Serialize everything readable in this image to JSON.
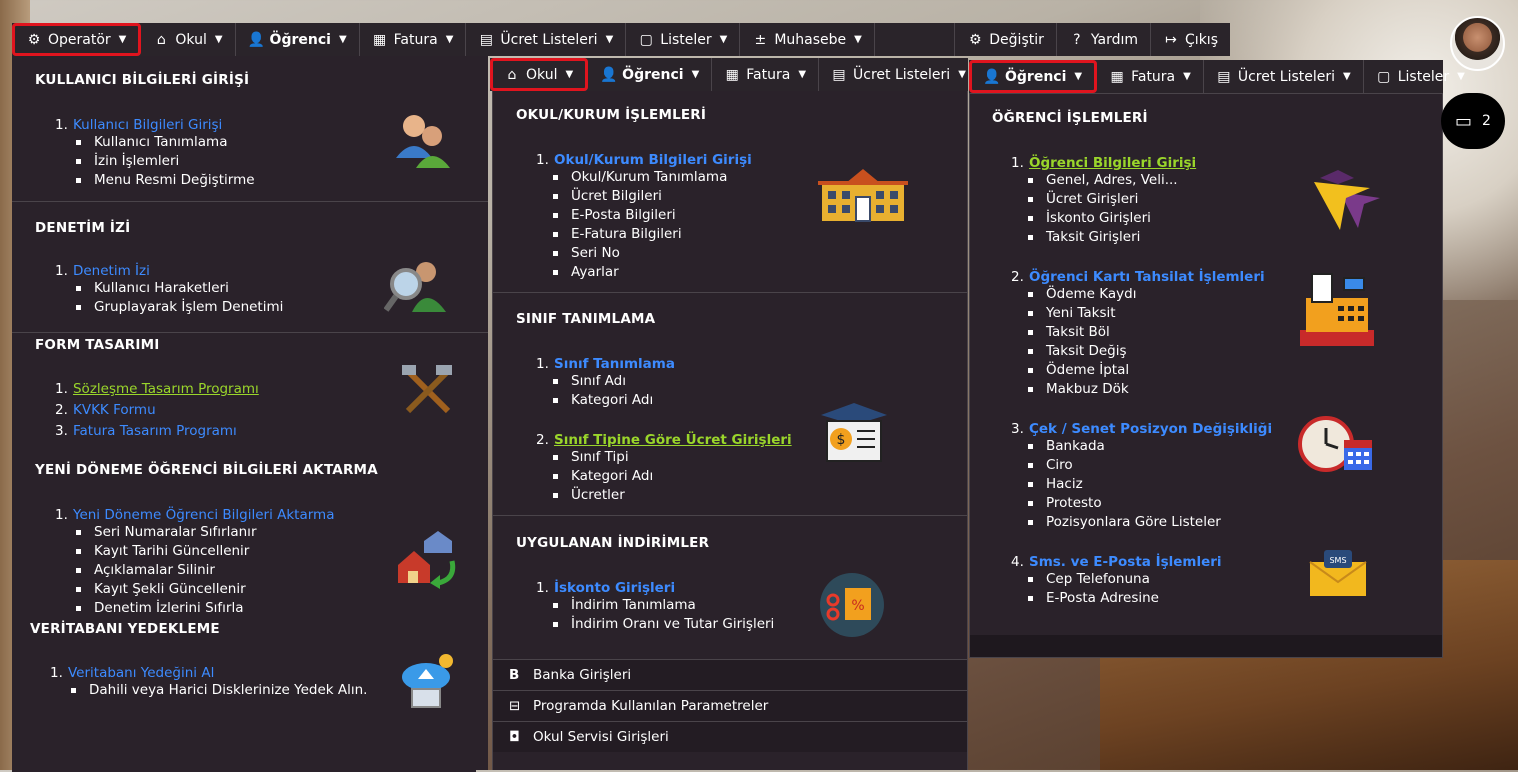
{
  "topbar": {
    "items": [
      {
        "label": "Operatör",
        "icon": "gears-icon"
      },
      {
        "label": "Okul",
        "icon": "home-icon"
      },
      {
        "label": "Öğrenci",
        "icon": "user-icon"
      },
      {
        "label": "Fatura",
        "icon": "calculator-icon"
      },
      {
        "label": "Ücret Listeleri",
        "icon": "document-icon"
      },
      {
        "label": "Listeler",
        "icon": "list-icon"
      },
      {
        "label": "Muhasebe",
        "icon": "plus-minus-icon"
      }
    ],
    "right_items": [
      {
        "label": "Değiştir",
        "icon": "gear-icon"
      },
      {
        "label": "Yardım",
        "icon": "help-icon"
      },
      {
        "label": "Çıkış",
        "icon": "exit-icon"
      }
    ]
  },
  "bar2": {
    "items": [
      {
        "label": "Okul"
      },
      {
        "label": "Öğrenci"
      },
      {
        "label": "Fatura"
      },
      {
        "label": "Ücret Listeleri"
      }
    ]
  },
  "bar3": {
    "items": [
      {
        "label": "Öğrenci"
      },
      {
        "label": "Fatura"
      },
      {
        "label": "Ücret Listeleri"
      },
      {
        "label": "Listeler"
      }
    ]
  },
  "operator_menu": {
    "s1": {
      "title": "KULLANICI BİLGİLERİ GİRİŞİ",
      "num": "1.",
      "link": "Kullanıcı Bilgileri Girişi",
      "subs": [
        "Kullanıcı Tanımlama",
        "İzin İşlemleri",
        "Menu Resmi Değiştirme"
      ]
    },
    "s2": {
      "title": "DENETİM İZİ",
      "num": "1.",
      "link": "Denetim İzi",
      "subs": [
        "Kullanıcı Haraketleri",
        "Gruplayarak İşlem Denetimi"
      ]
    },
    "s3": {
      "title": "FORM TASARIMI",
      "links": [
        {
          "num": "1.",
          "label": "Sözleşme Tasarım Programı"
        },
        {
          "num": "2.",
          "label": "KVKK Formu"
        },
        {
          "num": "3.",
          "label": "Fatura Tasarım Programı"
        }
      ]
    },
    "s4": {
      "title": "YENİ DÖNEME ÖĞRENCİ BİLGİLERİ AKTARMA",
      "num": "1.",
      "link": "Yeni Döneme Öğrenci Bilgileri Aktarma",
      "subs": [
        "Seri Numaralar Sıfırlanır",
        "Kayıt Tarihi Güncellenir",
        "Açıklamalar Silinir",
        "Kayıt Şekli Güncellenir",
        "Denetim İzlerini Sıfırla"
      ]
    },
    "s5": {
      "title": "VERİTABANI YEDEKLEME",
      "num": "1.",
      "link": "Veritabanı Yedeğini Al",
      "subs": [
        "Dahili veya Harici Disklerinize Yedek Alın."
      ]
    }
  },
  "okul_menu": {
    "s1": {
      "title": "OKUL/KURUM İŞLEMLERİ",
      "num": "1.",
      "link": "Okul/Kurum Bilgileri Girişi",
      "subs": [
        "Okul/Kurum Tanımlama",
        "Ücret Bilgileri",
        "E-Posta Bilgileri",
        "E-Fatura Bilgileri",
        "Seri No",
        "Ayarlar"
      ]
    },
    "s2": {
      "title": "SINIF TANIMLAMA",
      "num1": "1.",
      "link1": "Sınıf Tanımlama",
      "subs1": [
        "Sınıf Adı",
        "Kategori Adı"
      ],
      "num2": "2.",
      "link2": "Sınıf Tipine Göre Ücret Girişleri",
      "subs2": [
        "Sınıf Tipi",
        "Kategori Adı",
        "Ücretler"
      ]
    },
    "s3": {
      "title": "UYGULANAN İNDİRİMLER",
      "num": "1.",
      "link": "İskonto Girişleri",
      "subs": [
        "İndirim Tanımlama",
        "İndirim Oranı ve Tutar Girişleri"
      ]
    },
    "bottom": [
      {
        "label": "Banka Girişleri",
        "icon": "bank-b-icon"
      },
      {
        "label": "Programda Kullanılan Parametreler",
        "icon": "sliders-icon"
      },
      {
        "label": "Okul Servisi Girişleri",
        "icon": "bus-icon"
      }
    ]
  },
  "ogrenci_menu": {
    "s1": {
      "title": "ÖĞRENCİ İŞLEMLERİ",
      "num": "1.",
      "link": "Öğrenci Bilgileri Girişi",
      "subs": [
        "Genel, Adres, Veli...",
        "Ücret Girişleri",
        "İskonto Girişleri",
        "Taksit Girişleri"
      ]
    },
    "s2": {
      "num": "2.",
      "link": "Öğrenci Kartı Tahsilat İşlemleri",
      "subs": [
        "Ödeme Kaydı",
        "Yeni Taksit",
        "Taksit Böl",
        "Taksit Değiş",
        "Ödeme İptal",
        "Makbuz Dök"
      ]
    },
    "s3": {
      "num": "3.",
      "link": "Çek / Senet Posizyon Değişikliği",
      "subs": [
        "Bankada",
        "Ciro",
        "Haciz",
        "Protesto",
        "Pozisyonlara Göre Listeler"
      ]
    },
    "s4": {
      "num": "4.",
      "link": "Sms. ve E-Posta İşlemleri",
      "subs": [
        "Cep Telefonuna",
        "E-Posta Adresine"
      ]
    }
  },
  "chat": {
    "count": "2"
  },
  "colors": {
    "panel": "#2a222a",
    "link": "#3d8bff",
    "link_active": "#9ad62b",
    "highlight": "#e0141e"
  }
}
